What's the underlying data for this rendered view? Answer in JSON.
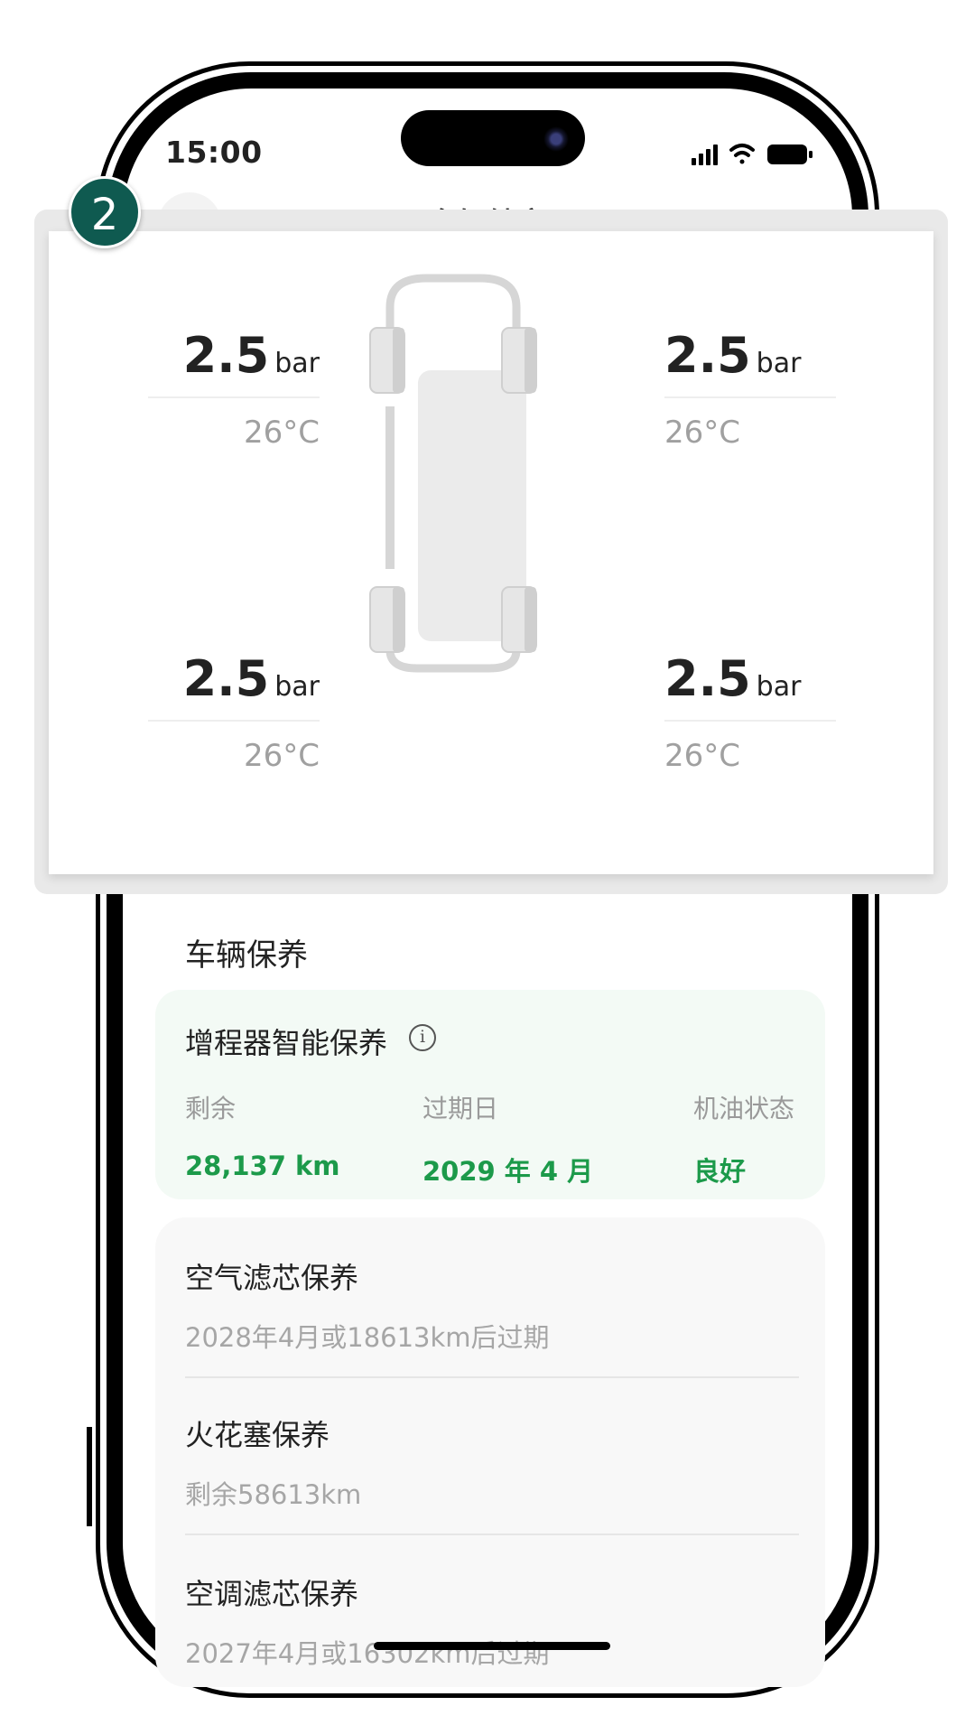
{
  "status_bar": {
    "time": "15:00"
  },
  "nav": {
    "title": "车辆健康",
    "back_icon": "chevron-left-icon"
  },
  "step_badge": "2",
  "tires": {
    "front_left": {
      "pressure": "2.5",
      "unit": "bar",
      "temp": "26°C"
    },
    "front_right": {
      "pressure": "2.5",
      "unit": "bar",
      "temp": "26°C"
    },
    "rear_left": {
      "pressure": "2.5",
      "unit": "bar",
      "temp": "26°C"
    },
    "rear_right": {
      "pressure": "2.5",
      "unit": "bar",
      "temp": "26°C"
    }
  },
  "maintenance": {
    "section_title": "车辆保养",
    "engine": {
      "title": "增程器智能保养",
      "remaining_label": "剩余",
      "remaining_value": "28,137 km",
      "expiry_label": "过期日",
      "expiry_value": "2029 年 4 月",
      "oil_label": "机油状态",
      "oil_value": "良好"
    },
    "items": [
      {
        "title": "空气滤芯保养",
        "subtitle": "2028年4月或18613km后过期"
      },
      {
        "title": "火花塞保养",
        "subtitle": "剩余58613km"
      },
      {
        "title": "空调滤芯保养",
        "subtitle": "2027年4月或16302km后过期"
      }
    ]
  },
  "colors": {
    "accent_green": "#1c9a4a",
    "badge_teal": "#0f5a50",
    "engine_card_bg": "#f3faf5"
  }
}
